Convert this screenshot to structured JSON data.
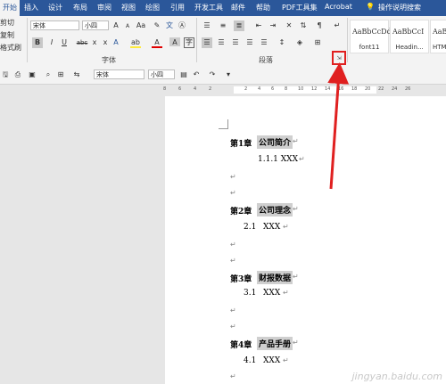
{
  "tabs": [
    {
      "label": "开始",
      "active": true
    },
    {
      "label": "插入"
    },
    {
      "label": "设计"
    },
    {
      "label": "布局"
    },
    {
      "label": "审阅"
    },
    {
      "label": "视图"
    },
    {
      "label": "绘图"
    },
    {
      "label": "引用"
    },
    {
      "label": "开发工具"
    },
    {
      "label": "邮件"
    },
    {
      "label": "帮助"
    },
    {
      "label": "PDF工具集"
    },
    {
      "label": "Acrobat"
    },
    {
      "label": "操作说明搜索"
    }
  ],
  "clipboard": {
    "cut": "剪切",
    "copy": "复制",
    "format_painter": "格式刷"
  },
  "font_group": {
    "font_name": "宋体",
    "font_size": "小四",
    "grow": "A",
    "shrink": "A",
    "case": "Aa",
    "bold": "B",
    "italic": "I",
    "underline": "U",
    "strike": "abc",
    "subscript": "x",
    "superscript": "x",
    "label": "字体"
  },
  "paragraph_group": {
    "label": "段落"
  },
  "styles": [
    {
      "sample": "AaBbCcDd",
      "name": "font11"
    },
    {
      "sample": "AaBbCcI",
      "name": "Headin..."
    },
    {
      "sample": "AaBbC",
      "name": "HTM"
    }
  ],
  "qat": {
    "font_name": "宋体",
    "font_size": "小四"
  },
  "ruler": {
    "ticks": [
      "8",
      "6",
      "4",
      "2",
      "",
      "2",
      "4",
      "6",
      "8",
      "10",
      "12",
      "14",
      "16",
      "18",
      "20",
      "22",
      "24",
      "26"
    ]
  },
  "document": {
    "chapters": [
      {
        "label": "第1章",
        "title": "公司简介",
        "sub": "1.1.1 XXX"
      },
      {
        "label": "第2章",
        "title": "公司理念",
        "sub_num": "2.1",
        "sub": "XXX"
      },
      {
        "label": "第3章",
        "title": "财报数据",
        "sub_num": "3.1",
        "sub": "XXX"
      },
      {
        "label": "第4章",
        "title": "产品手册",
        "sub_num": "4.1",
        "sub": "XXX"
      }
    ],
    "para_mark": "↵"
  },
  "watermark": "jingyan.baidu.com",
  "colors": {
    "tabbar": "#2b579a",
    "ribbon": "#f3f3f3",
    "annotation": "#e02020",
    "highlight": "#cfcfcf"
  }
}
